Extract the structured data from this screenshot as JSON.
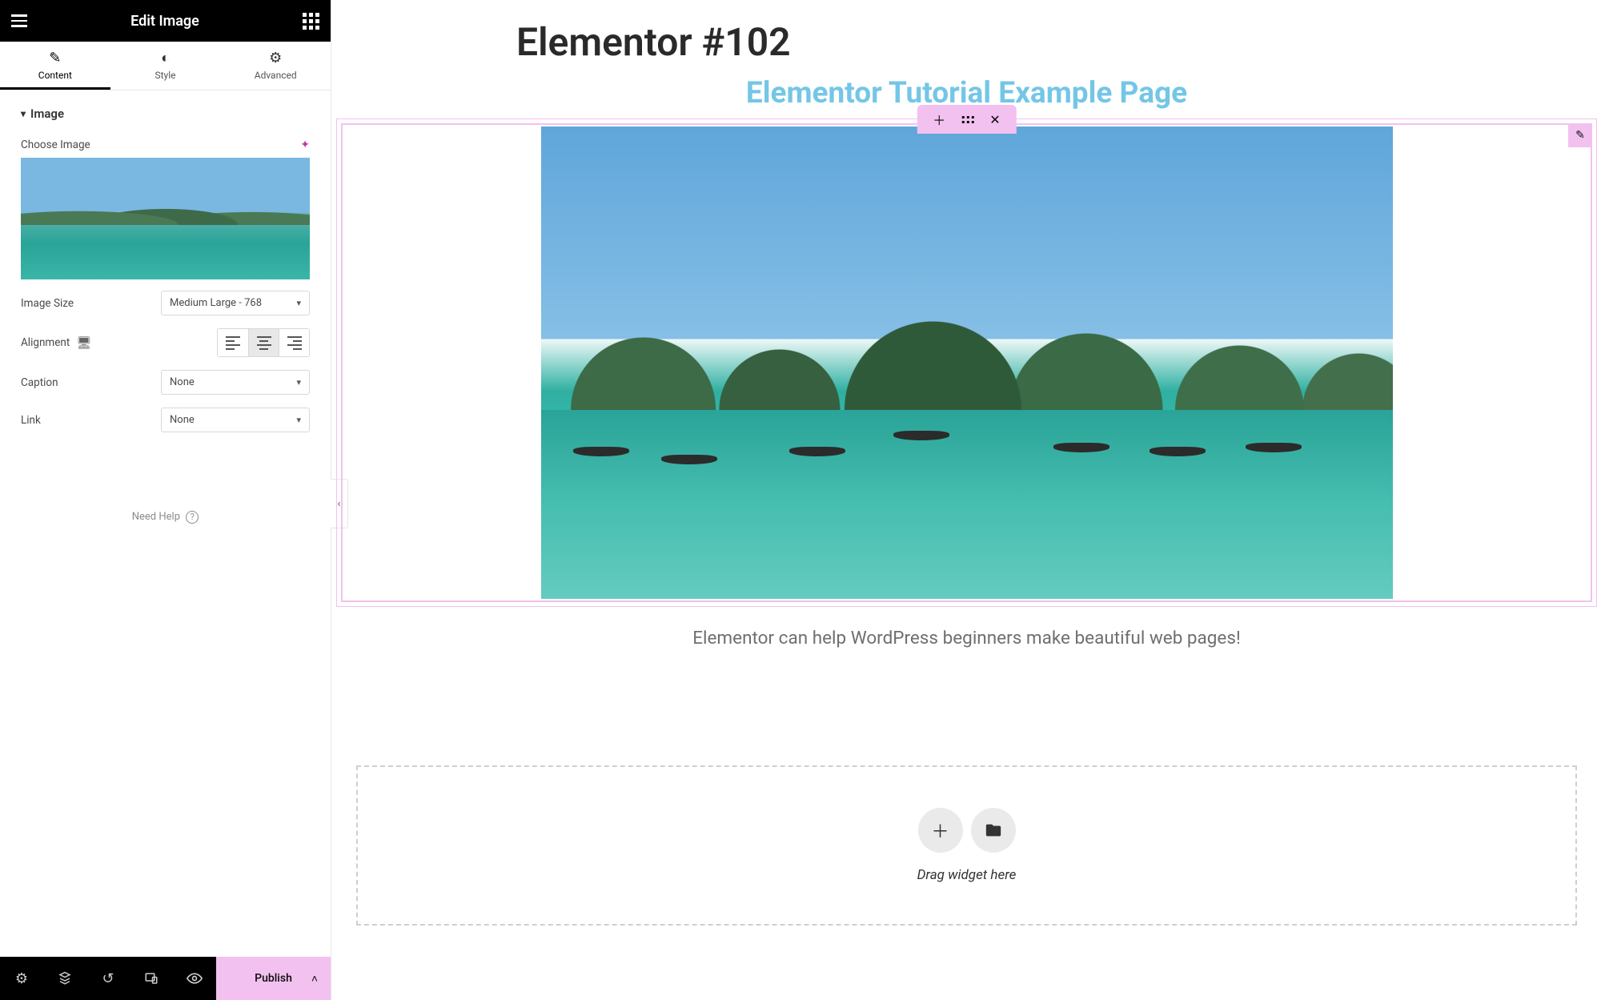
{
  "panel": {
    "title": "Edit Image",
    "tabs": {
      "content": "Content",
      "style": "Style",
      "advanced": "Advanced",
      "active": "content"
    },
    "section": "Image",
    "choose_image_label": "Choose Image",
    "image_size_label": "Image Size",
    "image_size_value": "Medium Large - 768",
    "alignment_label": "Alignment",
    "alignment_value": "center",
    "caption_label": "Caption",
    "caption_value": "None",
    "link_label": "Link",
    "link_value": "None",
    "help": "Need Help"
  },
  "footer": {
    "publish": "Publish"
  },
  "canvas": {
    "page_title": "Elementor #102",
    "subtitle": "Elementor Tutorial Example Page",
    "caption": "Elementor can help WordPress beginners make beautiful web pages!",
    "drop_hint": "Drag widget here"
  }
}
